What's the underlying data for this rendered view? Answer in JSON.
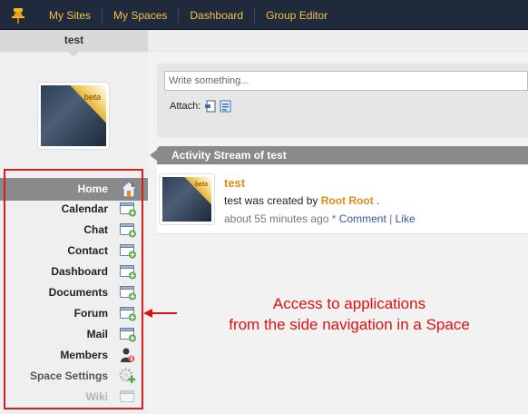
{
  "topbar": {
    "pin_icon": "pushpin-icon",
    "items": [
      {
        "label": "My Sites"
      },
      {
        "label": "My Spaces"
      },
      {
        "label": "Dashboard"
      },
      {
        "label": "Group Editor"
      }
    ]
  },
  "space": {
    "name": "test",
    "avatar_badge": "beta",
    "home_label": "Home",
    "apps": [
      {
        "label": "Calendar",
        "icon": "app-add-icon"
      },
      {
        "label": "Chat",
        "icon": "app-add-icon"
      },
      {
        "label": "Contact",
        "icon": "app-add-icon"
      },
      {
        "label": "Dashboard",
        "icon": "app-add-icon"
      },
      {
        "label": "Documents",
        "icon": "app-add-icon"
      },
      {
        "label": "Forum",
        "icon": "app-add-icon"
      },
      {
        "label": "Mail",
        "icon": "app-add-icon"
      },
      {
        "label": "Members",
        "icon": "members-icon"
      },
      {
        "label": "Space Settings",
        "icon": "settings-gear-icon"
      },
      {
        "label": "Wiki",
        "icon": "app-add-icon"
      }
    ]
  },
  "composer": {
    "placeholder": "Write something...",
    "attach_label": "Attach:"
  },
  "stream": {
    "title": "Activity Stream of test",
    "activity": {
      "title": "test",
      "text_prefix": "test was created by",
      "user": "Root Root",
      "text_suffix": ".",
      "time": "about 55 minutes ago",
      "separator": "*",
      "comment_label": "Comment",
      "pipe": "|",
      "like_label": "Like",
      "avatar_badge": "beta"
    }
  },
  "annotation": {
    "line1": "Access to applications",
    "line2": "from the side navigation in a Space"
  },
  "colors": {
    "topbar_bg": "#1f2b3d",
    "topbar_link": "#f0c343",
    "highlight_red": "#d42020",
    "accent_orange": "#e08a18",
    "nav_gray": "#8a8a8a"
  }
}
